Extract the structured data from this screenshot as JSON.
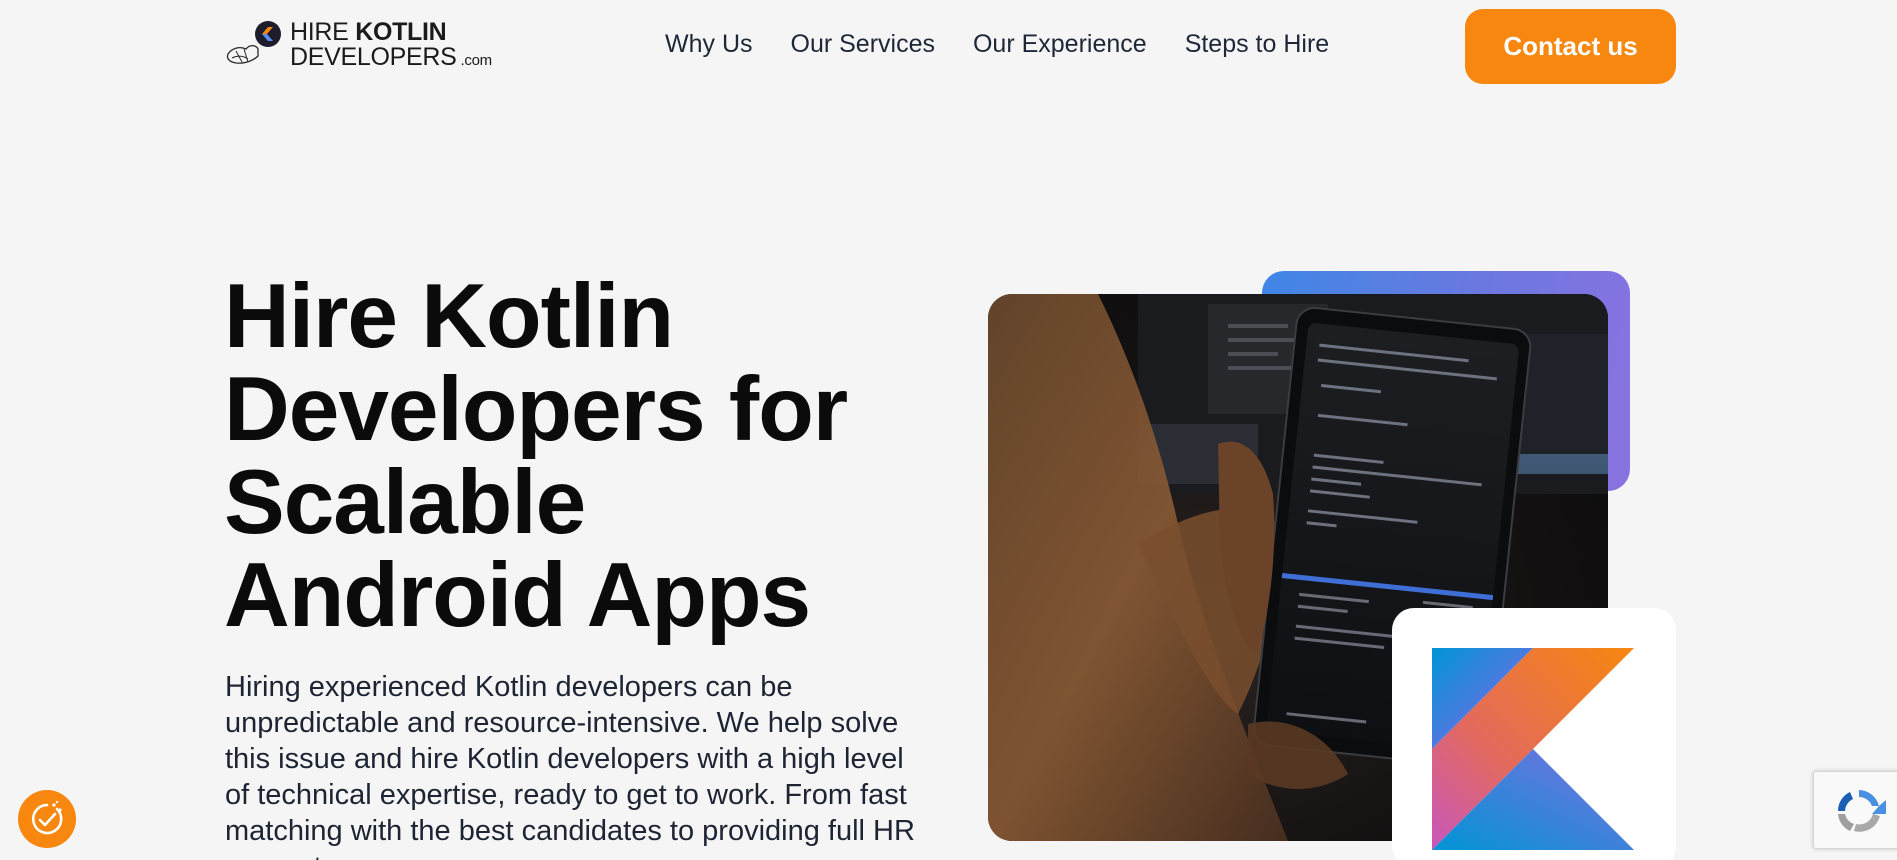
{
  "brand": {
    "line1_prefix": "HIRE ",
    "line1_bold": "KOTLIN",
    "line2": "DEVELOPERS",
    "suffix": ".com"
  },
  "nav": {
    "items": [
      {
        "label": "Why Us"
      },
      {
        "label": "Our Services"
      },
      {
        "label": "Our Experience"
      },
      {
        "label": "Steps to Hire"
      }
    ],
    "cta_label": "Contact us"
  },
  "hero": {
    "title": "Hire Kotlin Developers for Scalable Android Apps",
    "description": "Hiring experienced Kotlin developers can be unpredictable and resource-intensive. We help solve this issue and hire Kotlin developers with a high level of technical expertise, ready to get to work. From fast matching with the best candidates to providing full HR support",
    "photo_icon": "developer-holding-tablet-photo",
    "badge_icon": "kotlin-logo-icon"
  },
  "widgets": {
    "cookie_icon": "cookie-settings-icon",
    "captcha_icon": "recaptcha-icon"
  },
  "colors": {
    "accent": "#f7870f",
    "background": "#f5f5f5",
    "text_dark": "#0b0b0b",
    "nav_text": "#1e2738",
    "accent_gradient_start": "#3f86e6",
    "accent_gradient_end": "#8a72e0"
  }
}
